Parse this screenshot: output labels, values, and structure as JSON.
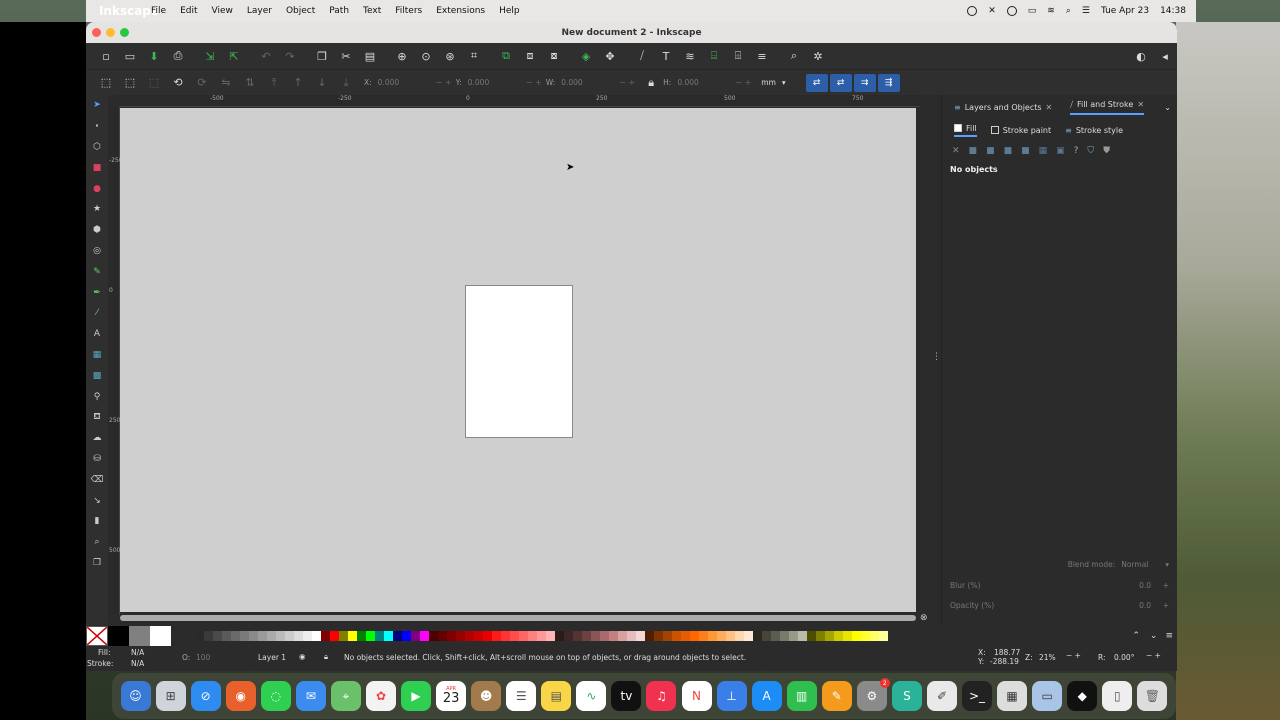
{
  "menubar": {
    "app_name": "Inkscape",
    "items": [
      "File",
      "Edit",
      "View",
      "Layer",
      "Object",
      "Path",
      "Text",
      "Filters",
      "Extensions",
      "Help"
    ],
    "date": "Tue Apr 23",
    "time": "14:38"
  },
  "window": {
    "title": "New document 2 - Inkscape"
  },
  "toolctl": {
    "x_label": "X:",
    "x_value": "0.000",
    "y_label": "Y:",
    "y_value": "0.000",
    "w_label": "W:",
    "w_value": "0.000",
    "h_label": "H:",
    "h_value": "0.000",
    "unit": "mm"
  },
  "ruler": {
    "h_ticks": [
      "-500",
      "-250",
      "0",
      "250",
      "500",
      "750"
    ],
    "v_ticks": [
      "-250",
      "0",
      "250",
      "500"
    ]
  },
  "panel": {
    "tab1": "Layers and Objects",
    "tab2": "Fill and Stroke",
    "sub_fill": "Fill",
    "sub_stroke_paint": "Stroke paint",
    "sub_stroke_style": "Stroke style",
    "no_objects": "No objects",
    "blend_label": "Blend mode:",
    "blend_value": "Normal",
    "blur_label": "Blur (%)",
    "blur_value": "0.0",
    "opacity_label": "Opacity (%)",
    "opacity_value": "0.0"
  },
  "status": {
    "fill_label": "Fill:",
    "fill_value": "N/A",
    "stroke_label": "Stroke:",
    "stroke_value": "N/A",
    "o_label": "O:",
    "o_value": "100",
    "layer": "Layer 1",
    "message": "No objects selected. Click, Shift+click, Alt+scroll mouse on top of objects, or drag around objects to select.",
    "x_label": "X:",
    "x_value": "188.77",
    "y_label": "Y:",
    "y_value": "-288.19",
    "z_label": "Z:",
    "zoom": "21%",
    "r_label": "R:",
    "rotation": "0.00°"
  },
  "dock": {
    "calendar_month": "APR",
    "calendar_day": "23",
    "settings_badge": "2"
  }
}
